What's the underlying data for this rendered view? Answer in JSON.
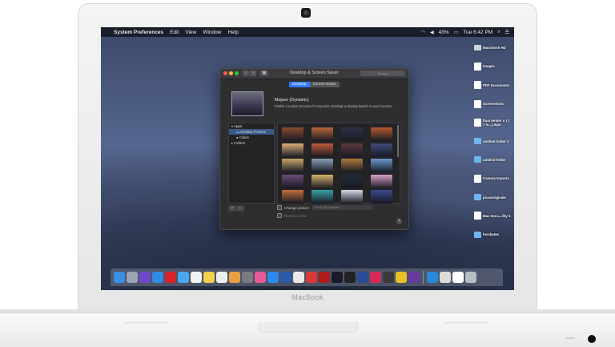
{
  "device": {
    "brand": "MacBook"
  },
  "menubar": {
    "app_name": "System Preferences",
    "items": [
      "Edit",
      "View",
      "Window",
      "Help"
    ],
    "battery": "43%",
    "clock": "Tue 6:42 PM"
  },
  "desktop_icons": [
    {
      "label": "Macintosh HD",
      "icon": "disk-icon"
    },
    {
      "label": "Images",
      "icon": "document-icon"
    },
    {
      "label": "PDF Documents",
      "icon": "document-icon"
    },
    {
      "label": "Screenshots",
      "icon": "document-icon"
    },
    {
      "label": "final render v 1 ( 7 lo...).mp4",
      "icon": "video-file-icon"
    },
    {
      "label": "untitled folder 2",
      "icon": "folder-icon"
    },
    {
      "label": "untitled folder",
      "icon": "folder-icon"
    },
    {
      "label": "Camera Imports",
      "icon": "document-icon"
    },
    {
      "label": "picasoriginals",
      "icon": "folder-icon"
    },
    {
      "label": "Mac Secu...ility-1",
      "icon": "document-icon"
    },
    {
      "label": "fossbytes",
      "icon": "folder-icon"
    }
  ],
  "prefs_window": {
    "title": "Desktop & Screen Saver",
    "search_placeholder": "Search",
    "tabs": [
      "Desktop",
      "Screen Saver"
    ],
    "active_tab": "Desktop",
    "wallpaper_name": "Mojave (Dynamic)",
    "wallpaper_description": "Enable Location Services for Dynamic Desktop to display based on your location.",
    "sidebar": {
      "group_apple": "Apple",
      "desktop_pictures": "Desktop Pictures",
      "colors": "Colors",
      "group_folders": "Folders"
    },
    "add_symbol": "+",
    "remove_symbol": "−",
    "change_picture_label": "Change picture:",
    "change_picture_value": "Every 30 minutes",
    "random_order_label": "Random order",
    "help_symbol": "?",
    "thumbnails": [
      [
        "#8a4a2e",
        "#b8663a",
        "#2d3247",
        "#b35a2d"
      ],
      [
        "#d8b07a",
        "#c05a3a",
        "#5a3a3a",
        "#3e4a7a"
      ],
      [
        "#c9a56a",
        "#8aa0b8",
        "#a87a3a",
        "#6a9ad0"
      ],
      [
        "#6a4a7a",
        "#d6b46a",
        "#1e2a3a",
        "#d8a0c8"
      ],
      [
        "#c0703a",
        "#3aa0a8",
        "#d2d8e0",
        "#3a4a8a"
      ]
    ]
  },
  "dock_icons": [
    {
      "name": "finder-icon",
      "color": "#3a8ee6"
    },
    {
      "name": "launchpad-icon",
      "color": "#9aa4b4"
    },
    {
      "name": "siri-icon",
      "color": "#6a4ac8"
    },
    {
      "name": "safari-icon",
      "color": "#2f8ce8"
    },
    {
      "name": "opera-icon",
      "color": "#d8222a"
    },
    {
      "name": "mail-icon",
      "color": "#4aa8f0"
    },
    {
      "name": "calendar-icon",
      "color": "#f2f2f2"
    },
    {
      "name": "notes-icon",
      "color": "#f2d24a"
    },
    {
      "name": "reminders-icon",
      "color": "#eeeeee"
    },
    {
      "name": "photos-icon",
      "color": "#e8a040"
    },
    {
      "name": "system-preferences-icon",
      "color": "#7a7a80"
    },
    {
      "name": "itunes-icon",
      "color": "#e85a9a"
    },
    {
      "name": "app-store-icon",
      "color": "#2a8af0"
    },
    {
      "name": "virtualbox-icon",
      "color": "#2a5aa8"
    },
    {
      "name": "monodraw-icon",
      "color": "#e8e8e8"
    },
    {
      "name": "preview-icon",
      "color": "#d83a3a"
    },
    {
      "name": "photo-booth-icon",
      "color": "#b01a1a"
    },
    {
      "name": "screen-capture-icon",
      "color": "#1a1a2a"
    },
    {
      "name": "terminal-icon",
      "color": "#222222"
    },
    {
      "name": "network-icon",
      "color": "#2a4a9a"
    },
    {
      "name": "lips-app-icon",
      "color": "#d82a5a"
    },
    {
      "name": "vivaldi-icon",
      "color": "#3a3a3a"
    },
    {
      "name": "chrome-icon",
      "color": "#e8c02a"
    },
    {
      "name": "tor-browser-icon",
      "color": "#6a3aa0"
    },
    {
      "name": "remote-desktop-icon",
      "color": "#2a88d8"
    },
    {
      "name": "downloads-stack-icon",
      "color": "#dcdcdc"
    },
    {
      "name": "documents-stack-icon",
      "color": "#ffffff"
    },
    {
      "name": "trash-icon",
      "color": "#b8bcc4"
    }
  ]
}
